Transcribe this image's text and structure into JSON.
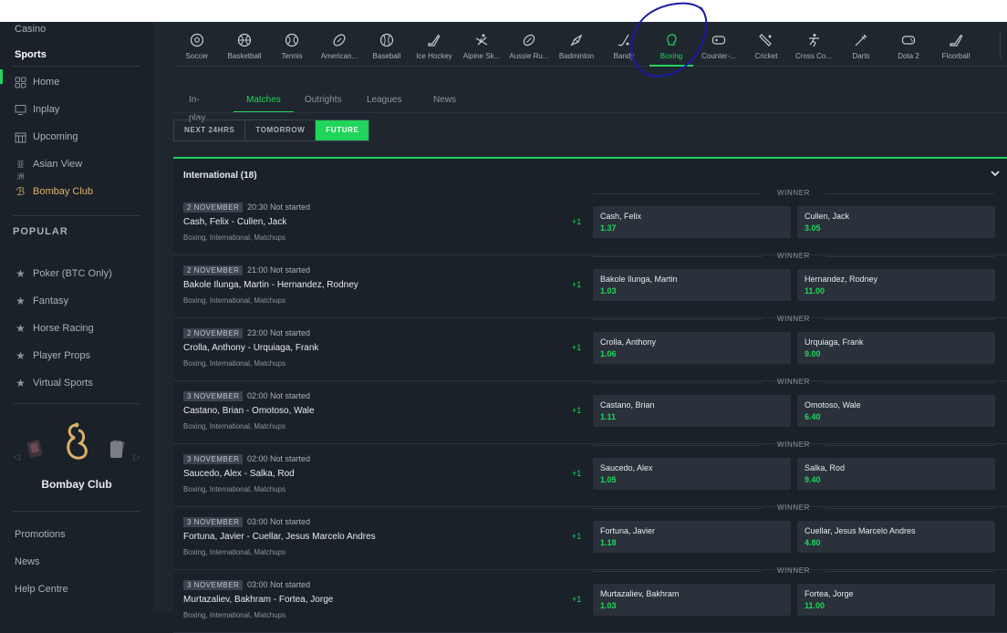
{
  "sidebar": {
    "top_item": "Casino",
    "sports": "Sports",
    "nav": [
      {
        "label": "Home",
        "icon": "home-icon"
      },
      {
        "label": "Inplay",
        "icon": "monitor-icon"
      },
      {
        "label": "Upcoming",
        "icon": "calendar-icon"
      },
      {
        "label": "Asian View",
        "icon": "asian-view-icon"
      },
      {
        "label": "Bombay Club",
        "icon": "bombay-club-icon"
      }
    ],
    "popular_heading": "POPULAR",
    "popular": [
      {
        "label": "Poker (BTC Only)",
        "icon": "star-icon"
      },
      {
        "label": "Fantasy",
        "icon": "star-icon"
      },
      {
        "label": "Horse Racing",
        "icon": "star-icon"
      },
      {
        "label": "Player Props",
        "icon": "star-icon"
      },
      {
        "label": "Virtual Sports",
        "icon": "star-icon"
      }
    ],
    "bombay_club_label": "Bombay Club",
    "footer": [
      "Promotions",
      "News",
      "Help Centre"
    ]
  },
  "sports": [
    {
      "label": "Soccer",
      "icon": "soccer-icon"
    },
    {
      "label": "Basketball",
      "icon": "basketball-icon"
    },
    {
      "label": "Tennis",
      "icon": "tennis-icon"
    },
    {
      "label": "American...",
      "icon": "american-football-icon"
    },
    {
      "label": "Baseball",
      "icon": "baseball-icon"
    },
    {
      "label": "Ice Hockey",
      "icon": "ice-hockey-icon"
    },
    {
      "label": "Alpine Sk...",
      "icon": "alpine-skiing-icon"
    },
    {
      "label": "Aussie Ru...",
      "icon": "aussie-rules-icon"
    },
    {
      "label": "Badminton",
      "icon": "badminton-icon"
    },
    {
      "label": "Bandy",
      "icon": "bandy-icon"
    },
    {
      "label": "Boxing",
      "icon": "boxing-icon",
      "active": true
    },
    {
      "label": "Counter-...",
      "icon": "counter-strike-icon"
    },
    {
      "label": "Cricket",
      "icon": "cricket-icon"
    },
    {
      "label": "Cross Co...",
      "icon": "cross-country-icon"
    },
    {
      "label": "Darts",
      "icon": "darts-icon"
    },
    {
      "label": "Dota 2",
      "icon": "dota-icon"
    },
    {
      "label": "Floorball",
      "icon": "floorball-icon"
    }
  ],
  "tabs": [
    "In-play",
    "Matches",
    "Outrights",
    "Leagues",
    "News"
  ],
  "active_tab": "Matches",
  "filters": [
    "NEXT 24HRS",
    "TOMORROW",
    "FUTURE"
  ],
  "active_filter": "FUTURE",
  "section": {
    "title": "International (18)"
  },
  "market_label": "WINNER",
  "events": [
    {
      "date": "2 NOVEMBER",
      "time": "20:30 Not started",
      "name": "Cash, Felix - Cullen, Jack",
      "category": "Boxing, International, Matchups",
      "more": "+1",
      "a_name": "Cash, Felix",
      "a_price": "1.37",
      "b_name": "Cullen, Jack",
      "b_price": "3.05"
    },
    {
      "date": "2 NOVEMBER",
      "time": "21:00 Not started",
      "name": "Bakole Ilunga, Martin - Hernandez, Rodney",
      "category": "Boxing, International, Matchups",
      "more": "+1",
      "a_name": "Bakole Ilunga, Martin",
      "a_price": "1.03",
      "b_name": "Hernandez, Rodney",
      "b_price": "11.00"
    },
    {
      "date": "2 NOVEMBER",
      "time": "23:00 Not started",
      "name": "Crolla, Anthony - Urquiaga, Frank",
      "category": "Boxing, International, Matchups",
      "more": "+1",
      "a_name": "Crolla, Anthony",
      "a_price": "1.06",
      "b_name": "Urquiaga, Frank",
      "b_price": "9.00"
    },
    {
      "date": "3 NOVEMBER",
      "time": "02:00 Not started",
      "name": "Castano, Brian - Omotoso, Wale",
      "category": "Boxing, International, Matchups",
      "more": "+1",
      "a_name": "Castano, Brian",
      "a_price": "1.11",
      "b_name": "Omotoso, Wale",
      "b_price": "6.40"
    },
    {
      "date": "3 NOVEMBER",
      "time": "02:00 Not started",
      "name": "Saucedo, Alex - Salka, Rod",
      "category": "Boxing, International, Matchups",
      "more": "+1",
      "a_name": "Saucedo, Alex",
      "a_price": "1.05",
      "b_name": "Salka, Rod",
      "b_price": "9.40"
    },
    {
      "date": "3 NOVEMBER",
      "time": "03:00 Not started",
      "name": "Fortuna, Javier - Cuellar, Jesus Marcelo Andres",
      "category": "Boxing, International, Matchups",
      "more": "+1",
      "a_name": "Fortuna, Javier",
      "a_price": "1.18",
      "b_name": "Cuellar, Jesus Marcelo Andres",
      "b_price": "4.80"
    },
    {
      "date": "3 NOVEMBER",
      "time": "03:00 Not started",
      "name": "Murtazaliev, Bakhram - Fortea, Jorge",
      "category": "Boxing, International, Matchups",
      "more": "+1",
      "a_name": "Murtazaliev, Bakhram",
      "a_price": "1.03",
      "b_name": "Fortea, Jorge",
      "b_price": "11.00"
    }
  ],
  "colors": {
    "accent": "#1fd55b",
    "annotation": "#1a1aa8"
  }
}
